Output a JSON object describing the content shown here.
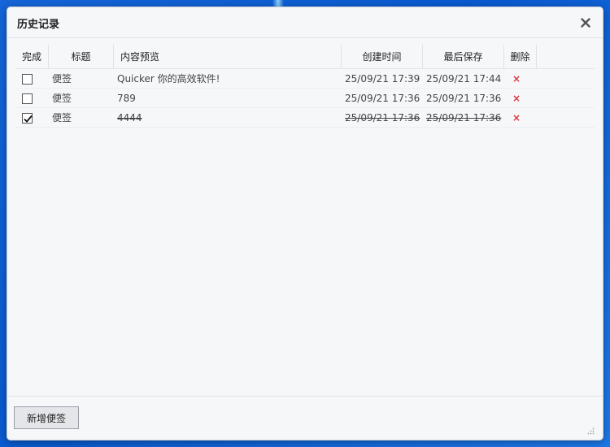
{
  "window": {
    "title": "历史记录",
    "close_icon": "close-icon"
  },
  "table": {
    "headers": {
      "done": "完成",
      "title": "标题",
      "preview": "内容预览",
      "created": "创建时间",
      "saved": "最后保存",
      "delete": "删除"
    },
    "rows": [
      {
        "done": false,
        "title": "便签",
        "preview": "Quicker 你的高效软件!",
        "created": "25/09/21 17:39",
        "saved": "25/09/21 17:44",
        "delete": "×"
      },
      {
        "done": false,
        "title": "便签",
        "preview": "789",
        "created": "25/09/21 17:36",
        "saved": "25/09/21 17:36",
        "delete": "×"
      },
      {
        "done": true,
        "title": "便签",
        "preview": "4444",
        "created": "25/09/21 17:36",
        "saved": "25/09/21 17:36",
        "delete": "×"
      }
    ]
  },
  "footer": {
    "add_button": "新增便签"
  },
  "colors": {
    "delete": "#d9363e",
    "window_bg": "#f6f7f9",
    "desktop": "#1565d8"
  }
}
